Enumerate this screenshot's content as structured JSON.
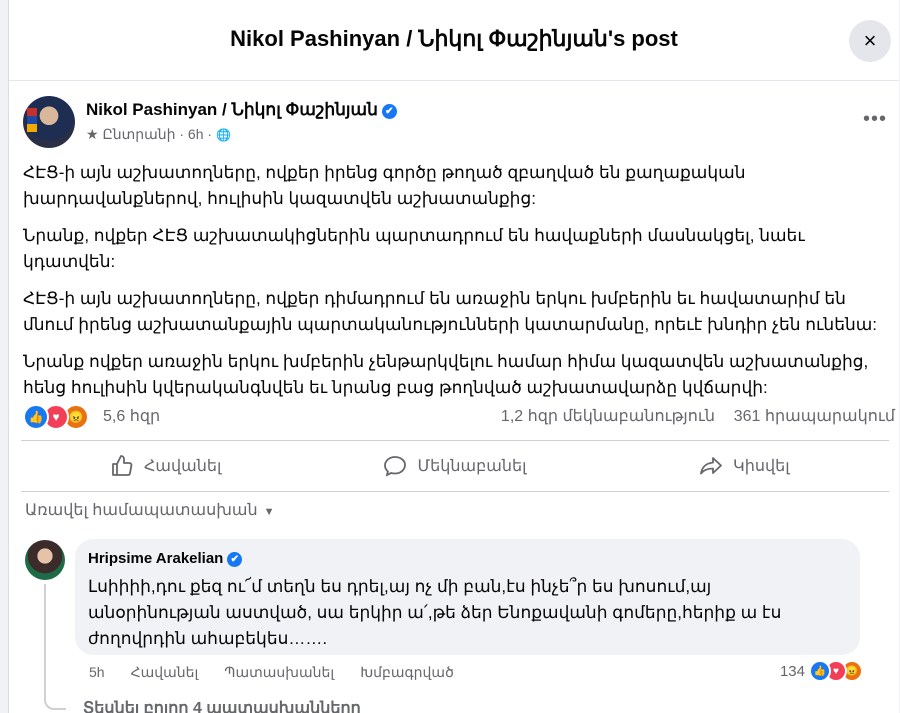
{
  "dialog": {
    "title": "Nikol Pashinyan / Նիկոլ Փաշինյան's post",
    "close_icon": "×"
  },
  "post": {
    "author": "Nikol Pashinyan / Նիկոլ Փաշինյան",
    "verified_icon": "✔",
    "audience_star": "★",
    "audience_label": "Ընտրանի",
    "time": "6h",
    "dot": "·",
    "globe_icon": "🌐",
    "more_icon": "•••",
    "paragraphs": [
      "ՀԷՑ-ի այն աշխատողները, ովքեր իրենց գործը թողած զբաղված են քաղաքական խարդավանքներով, հուլիսին կազատվեն աշխատանքից:",
      "Նրանք, ովքեր ՀԷՑ աշխատակիցներին պարտադրում են հավաքների մասնակցել, նաեւ կդատվեն:",
      "ՀԷՑ-ի այն աշխատողները, ովքեր դիմադրում են առաջին երկու խմբերին եւ հավատարիմ են մնում իրենց աշխատանքային պարտականությունների կատարմանը, որեւէ խնդիր չեն ունենա:",
      "Նրանք ովքեր առաջին երկու խմբերին չենթարկվելու համար հիմա կազատվեն աշխատանքից, հենց հուլիսին կվերականգնվեն եւ նրանց բաց թողնված աշխատավարձը կվճարվի:"
    ],
    "stats": {
      "reactions": "5,6 հզր",
      "comments": "1,2 հզր մեկնաբանություն",
      "shares": "361 հրապարակում"
    },
    "actions": {
      "like": "Հավանել",
      "comment": "Մեկնաբանել",
      "share": "Կիսվել"
    }
  },
  "comments_filter": "Առավել համապատասխան",
  "comment": {
    "author": "Hripsime Arakelian",
    "text": "Լսիիիի,դու քեզ ու՜մ տեղն ես դրել,այ ոչ մի բան,էս ինչե՞ր ես խոսում,այ անօրինության աստված, սա երկիր ա՛,թե ձեր Ենոքավանի գոմերը,հերիք ա էս ժողովրդին ահաբեկես…….",
    "time": "5h",
    "like": "Հավանել",
    "reply": "Պատասխանել",
    "edited": "Խմբագրված",
    "reaction_count": "134"
  },
  "see_replies": "Տեսնել բոլոր 4 պատասխանները",
  "colors": {
    "accent": "#1877f2",
    "love": "#f33e58",
    "angry": "#e9710f",
    "secondary_text": "#65676b"
  }
}
